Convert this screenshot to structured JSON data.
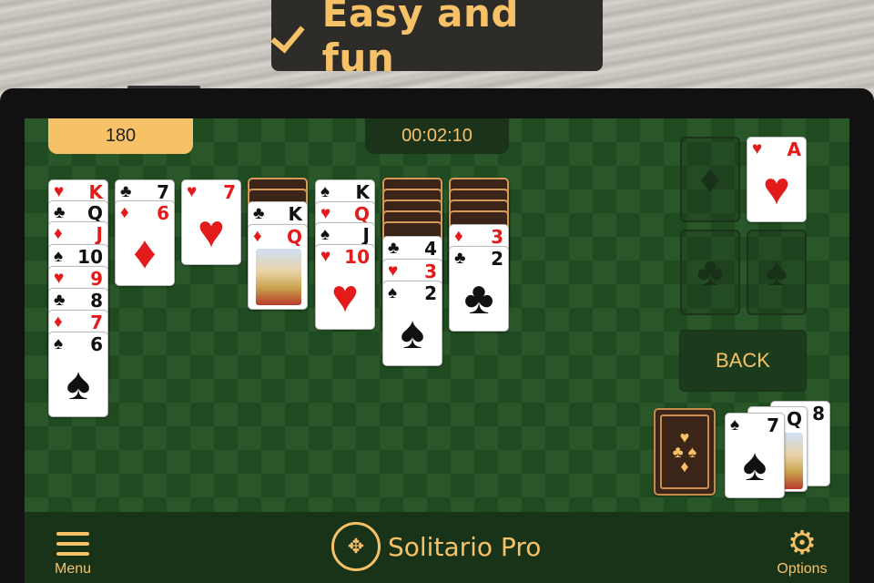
{
  "banner": {
    "text": "Easy and fun",
    "icon": "checkmark-icon"
  },
  "hud": {
    "score": "180",
    "timer": "00:02:10"
  },
  "tableau": [
    [
      {
        "rank": "K",
        "suit": "♥",
        "color": "red"
      },
      {
        "rank": "Q",
        "suit": "♣",
        "color": "black"
      },
      {
        "rank": "J",
        "suit": "♦",
        "color": "red"
      },
      {
        "rank": "10",
        "suit": "♠",
        "color": "black"
      },
      {
        "rank": "9",
        "suit": "♥",
        "color": "red"
      },
      {
        "rank": "8",
        "suit": "♣",
        "color": "black"
      },
      {
        "rank": "7",
        "suit": "♦",
        "color": "red"
      },
      {
        "rank": "6",
        "suit": "♠",
        "color": "black"
      }
    ],
    [
      {
        "rank": "7",
        "suit": "♣",
        "color": "black"
      },
      {
        "rank": "6",
        "suit": "♦",
        "color": "red"
      }
    ],
    [
      {
        "rank": "7",
        "suit": "♥",
        "color": "red"
      }
    ],
    [
      {
        "rank": "K",
        "suit": "♣",
        "color": "black"
      },
      {
        "rank": "Q",
        "suit": "♦",
        "color": "red"
      }
    ],
    [
      {
        "rank": "K",
        "suit": "♠",
        "color": "black"
      },
      {
        "rank": "Q",
        "suit": "♥",
        "color": "red"
      },
      {
        "rank": "J",
        "suit": "♠",
        "color": "black"
      },
      {
        "rank": "10",
        "suit": "♥",
        "color": "red"
      }
    ],
    [
      {
        "rank": "4",
        "suit": "♣",
        "color": "black"
      },
      {
        "rank": "3",
        "suit": "♥",
        "color": "red"
      },
      {
        "rank": "2",
        "suit": "♠",
        "color": "black"
      }
    ],
    [
      {
        "rank": "3",
        "suit": "♦",
        "color": "red"
      },
      {
        "rank": "2",
        "suit": "♣",
        "color": "black"
      }
    ]
  ],
  "foundations": {
    "hearts": {
      "rank": "A",
      "suit": "♥",
      "color": "red"
    },
    "diamonds_placeholder": "♦",
    "clubs_placeholder": "♣",
    "spades_placeholder": "♠"
  },
  "controls": {
    "back": "BACK"
  },
  "waste": [
    {
      "rank": "8",
      "suit": "♠",
      "color": "black"
    },
    {
      "rank": "Q",
      "suit": "♠",
      "color": "black"
    },
    {
      "rank": "7",
      "suit": "♠",
      "color": "black"
    }
  ],
  "bottom": {
    "menu": "Menu",
    "logo": "Solitario Pro",
    "options": "Options"
  },
  "colors": {
    "accent": "#f7c168",
    "felt": "#295729",
    "bar": "#193319"
  }
}
